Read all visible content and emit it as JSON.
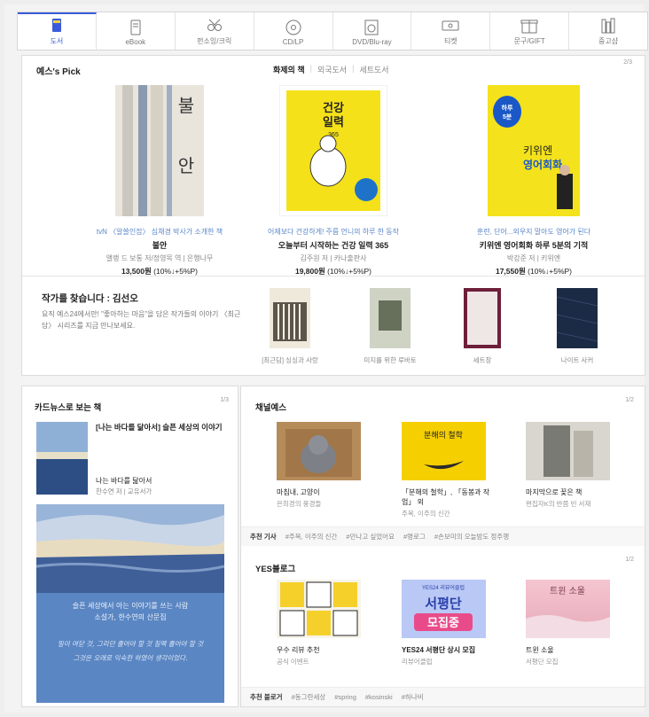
{
  "tabs": [
    {
      "label": "도서",
      "icon": "book-icon",
      "active": true
    },
    {
      "label": "eBook",
      "icon": "ebook-icon"
    },
    {
      "label": "펀소잉/크릭",
      "icon": "sewing-icon"
    },
    {
      "label": "CD/LP",
      "icon": "disc-icon"
    },
    {
      "label": "DVD/Blu-ray",
      "icon": "dvd-icon"
    },
    {
      "label": "티켓",
      "icon": "ticket-icon"
    },
    {
      "label": "문구/GIFT",
      "icon": "gift-icon"
    },
    {
      "label": "중고샵",
      "icon": "shop-icon"
    }
  ],
  "pick": {
    "title": "예스's Pick",
    "tabs": [
      "화제의 책",
      "외국도서",
      "세트도서"
    ],
    "page": "2/3",
    "books": [
      {
        "sub": "tvN 〈알쓸인잡〉 심채경 박사가 소개한 책",
        "title": "불안",
        "author": "앨랭 드 보통 저/정영목 역 | 은행나무",
        "price": "13,500원",
        "discount": "(10%↓+5%P)",
        "cover_text": "불 안"
      },
      {
        "sub": "어제보다 건강하게! 주름 언니의 하루 한 동작",
        "title": "오늘부터 시작하는 건강 일력 365",
        "author": "김주원 저 | 카나출판사",
        "price": "19,800원",
        "discount": "(10%↓+5%P)",
        "cover_text": "건강 일력 365"
      },
      {
        "sub": "훈련, 단어...외우지 말아도 영어가 된다",
        "title": "키위엔 영어회화 하루 5분의 기적",
        "author": "박강준 저 | 키위엔",
        "price": "17,550원",
        "discount": "(10%↓+5%P)",
        "cover_text": "키위엔 영어회화"
      }
    ]
  },
  "author": {
    "title": "작가를 찾습니다 : 김선오",
    "desc": "요직 예스24에서만! \"좋아하는 마음\"을 담은 작가들의 이야기 〈최근담〉 시리즈를 지금 만나보세요.",
    "books": [
      "[최근담] 싱싱과 사랑",
      "미지를 위한 루바토",
      "세트장",
      "나이트 사커"
    ]
  },
  "cardnews": {
    "title": "카드뉴스로 보는 책",
    "page": "1/3",
    "headline": "[나는 바다를 닮아서] 슬픈 세상의 이야기",
    "book": "나는 바다를 닮아서",
    "author": "한수연 저 | 교유서가",
    "quote1": "슬픈 세상에서 아는 이야기를 쓰는 사람\n소설가, 한수연의 산문집",
    "quote2": "밀이 여닫 것, 그리던 줄어야 할 것 칠팩 줄어야 할 것\n그것은 오래로 익숙한 하였어 생각이었다."
  },
  "channel": {
    "title": "채널예스",
    "page": "1/2",
    "items": [
      {
        "t": "마침내, 고양이",
        "s": "은희경의 풍경들"
      },
      {
        "t": "「분해의 철학」, 「동봉과 작업」 외",
        "s": "주목, 이주의 신간"
      },
      {
        "t": "마지막으로 꽂은 책",
        "s": "편집자K의 반쯤 빈 서재"
      }
    ],
    "tag_label": "추천 기사",
    "tags": [
      "#주목, 이주의 신간",
      "#만나고 싶었어요",
      "#명로그",
      "#손보미의 오늘밤도 정주행"
    ]
  },
  "blog": {
    "title": "YES블로그",
    "page": "1/2",
    "items": [
      {
        "t": "우수 리뷰 추천",
        "s": "공식 이벤트"
      },
      {
        "t": "YES24 서평단 상시 모집",
        "s": "리뷰어클럽"
      },
      {
        "t": "트윈 소울",
        "s": "서평단 모집"
      }
    ],
    "tag_label": "추천 블로거",
    "tags": [
      "#동그란세상",
      "#spring",
      "#kosinski",
      "#하나비"
    ],
    "promo_line1": "YES24 리뷰어클럽",
    "promo_line2": "서평단",
    "promo_line3": "모집중",
    "cover_text": "트윈 소울"
  },
  "colors": {
    "accent": "#3b5bdb",
    "sub_link": "#5a86c9",
    "yellow": "#f5e11a"
  }
}
